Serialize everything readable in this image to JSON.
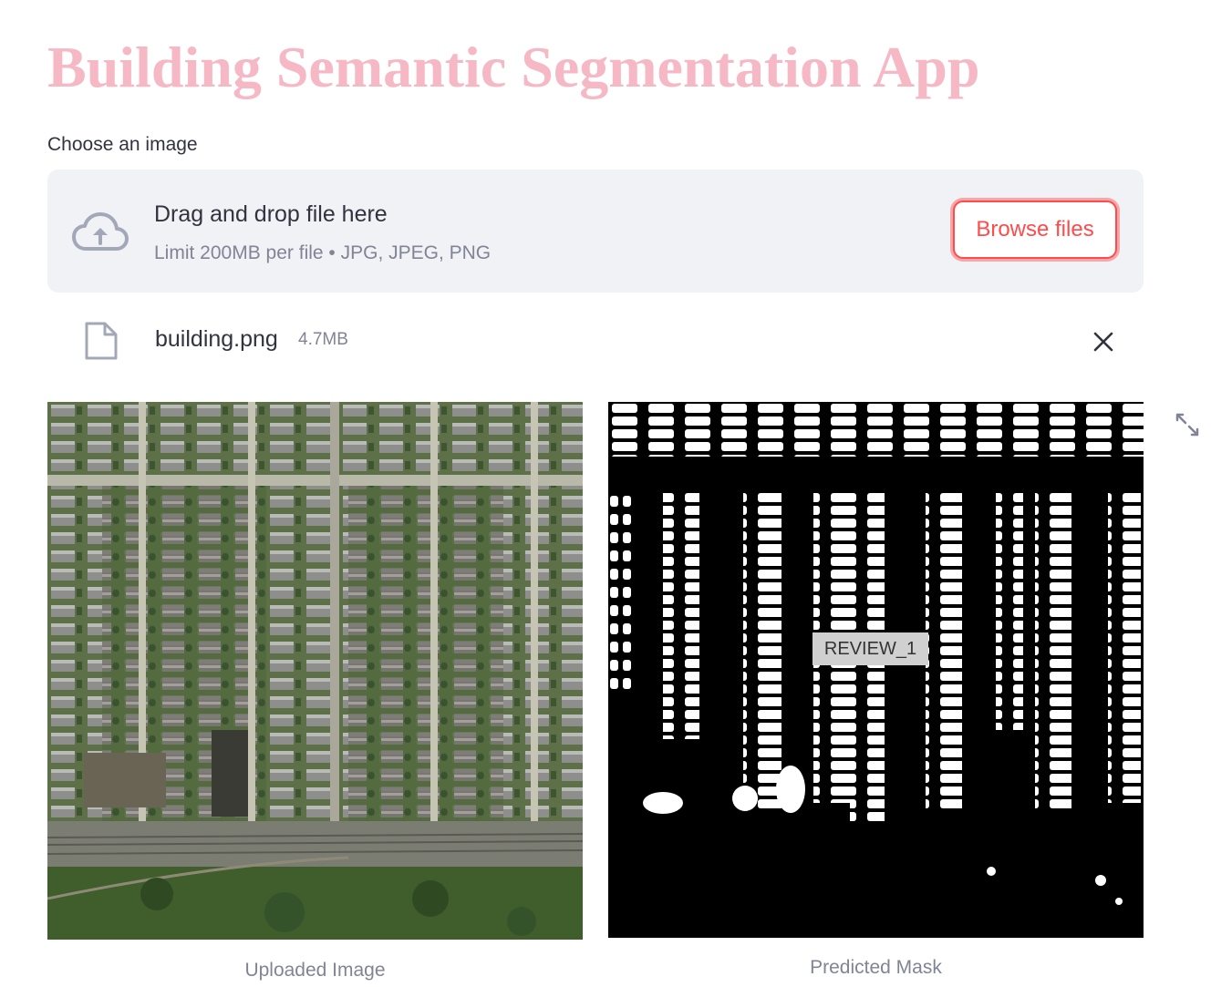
{
  "app": {
    "title": "Building Semantic Segmentation App"
  },
  "uploader": {
    "label": "Choose an image",
    "dropzone_title": "Drag and drop file here",
    "dropzone_subtitle": "Limit 200MB per file • JPG, JPEG, PNG",
    "browse_label": "Browse files",
    "cloud_icon": "cloud-upload-icon"
  },
  "file": {
    "name": "building.png",
    "size": "4.7MB",
    "file_icon": "file-icon",
    "remove_icon": "close-icon"
  },
  "images": {
    "uploaded_caption": "Uploaded Image",
    "mask_caption": "Predicted Mask",
    "fullscreen_icon": "expand-icon"
  },
  "overlay": {
    "badge": "REVIEW_1"
  },
  "colors": {
    "title": "#f5b8c4",
    "accent": "#ff4b4b",
    "dropzone_bg": "#f0f2f6",
    "muted_text": "#808495"
  }
}
